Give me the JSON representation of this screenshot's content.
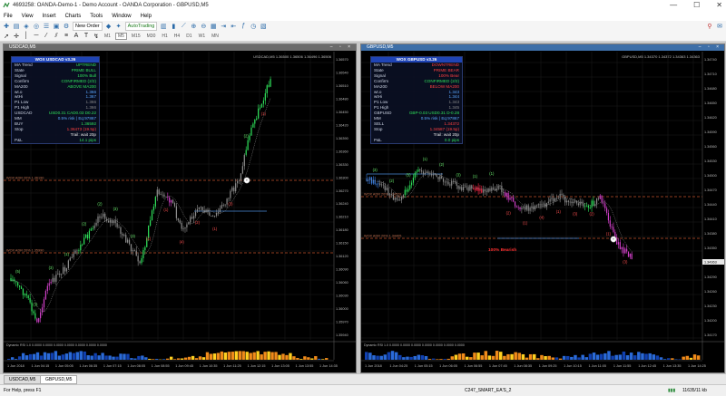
{
  "window": {
    "title": "4693258: OANDA-Demo-1 - Demo Account - OANDA Corporation - GBPUSD,M5",
    "controls": [
      "—",
      "☐",
      "✕"
    ]
  },
  "menu": [
    "File",
    "View",
    "Insert",
    "Charts",
    "Tools",
    "Window",
    "Help"
  ],
  "toolbar": {
    "new_order": "New Order",
    "autotrading": "AutoTrading",
    "timeframes": [
      "M1",
      "M5",
      "M15",
      "M30",
      "H1",
      "H4",
      "D1",
      "W1",
      "MN"
    ]
  },
  "left_chart": {
    "caption": "USDCAD,M5",
    "symbol_line": "USDCAD,M5 1.36500 1.36506 1.36496 1.36506",
    "indicator_caption": "Dynamic RSI 1.0 0.0000 0.0000 0.0000 0.0000 0.0000 0.0000 0.0000",
    "level_label_1": "WOX ADR 20% 1.36190",
    "level_label_2": "WOX ADR 20% 1.35990",
    "price_axis": [
      "1.36570",
      "1.36540",
      "1.36510",
      "1.36480",
      "1.36450",
      "1.36420",
      "1.36390",
      "1.36360",
      "1.36330",
      "1.36300",
      "1.36270",
      "1.36240",
      "1.36210",
      "1.36180",
      "1.36150",
      "1.36120",
      "1.36090",
      "1.36060",
      "1.36030",
      "1.36000",
      "1.35970",
      "1.35940"
    ],
    "time_axis": [
      "1 Jun 2018",
      "1 Jun 04:15",
      "1 Jun 05:05",
      "1 Jun 06:35",
      "1 Jun 07:15",
      "1 Jun 08:05",
      "1 Jun 08:55",
      "1 Jun 09:45",
      "1 Jun 10:35",
      "1 Jun 11:25",
      "1 Jun 12:15",
      "1 Jun 13:05",
      "1 Jun 13:55",
      "1 Jun 14:35"
    ],
    "panel": {
      "title": "WOX USDCAD v3.26",
      "rows": [
        {
          "k": "MA Trend",
          "v": "UPTREND",
          "c": "g"
        },
        {
          "k": "State",
          "v": "PRIME BULL",
          "c": "g"
        },
        {
          "k": "Signal",
          "v": "100% Bull",
          "c": "g"
        },
        {
          "k": "Confirm",
          "v": "CONFIRMED (2/2)",
          "c": "g"
        },
        {
          "k": "MA200",
          "v": "ABOVE MA200",
          "c": "g"
        },
        {
          "k": "wt.o",
          "v": "1.366",
          "c": "b"
        },
        {
          "k": "wtHi",
          "v": "1.367",
          "c": "b"
        },
        {
          "k": "P1 Low",
          "v": "1.366",
          "c": "gr"
        },
        {
          "k": "P1 High",
          "v": "1.366",
          "c": "gr"
        },
        {
          "k": "USDCAD",
          "v": "USD0.31 CAD0.03 D0.22",
          "c": "g"
        },
        {
          "k": "MM",
          "v": "0.5% risk | Eq:97867",
          "c": "b"
        },
        {
          "k": "BUY",
          "v": "1.36592",
          "c": "g"
        },
        {
          "k": "Stop",
          "v": "1.36473 (19.5p)",
          "c": "r"
        },
        {
          "k": "",
          "v": "Trail: wait 20p",
          "c": "w"
        },
        {
          "k": "P&L",
          "v": "14.1 pips",
          "c": "g"
        }
      ]
    },
    "swing_labels": [
      {
        "t": "(5)",
        "c": "g"
      },
      {
        "t": "(3)",
        "c": "g"
      },
      {
        "t": "(3)",
        "c": "g"
      },
      {
        "t": "(1)",
        "c": "g"
      },
      {
        "t": "(2)",
        "c": "g"
      },
      {
        "t": "(2)",
        "c": "g"
      },
      {
        "t": "(3)",
        "c": "g"
      },
      {
        "t": "(3)",
        "c": "g"
      },
      {
        "t": "(1)",
        "c": "r"
      },
      {
        "t": "(1)",
        "c": "r"
      },
      {
        "t": "(4)",
        "c": "r"
      },
      {
        "t": "(2)",
        "c": "r"
      },
      {
        "t": "(1)",
        "c": "r"
      },
      {
        "t": "(3)",
        "c": "r"
      },
      {
        "t": "(2)",
        "c": "g"
      },
      {
        "t": "(1)",
        "c": "r"
      }
    ]
  },
  "right_chart": {
    "caption": "GBPUSD,M5",
    "symbol_line": "GBPUSD,M5 1.34370 1.34372 1.34363 1.34363",
    "indicator_caption": "Dynamic RSI 1.0 0.0000 0.0000 0.0000 0.0000 0.0000 0.0000 0.0000",
    "level_label_1": "WOX ADR 20% 1.34528",
    "level_label_2": "WOX ADR 20% 1.34405",
    "signal_text": "100% Bearish",
    "current_price": "1.34363",
    "price_axis": [
      "1.34740",
      "1.34710",
      "1.34680",
      "1.34650",
      "1.34620",
      "1.34590",
      "1.34560",
      "1.34530",
      "1.34500",
      "1.34470",
      "1.34440",
      "1.34410",
      "1.34380",
      "1.34350",
      "1.34320",
      "1.34290",
      "1.34260",
      "1.34230",
      "1.34200",
      "1.34170"
    ],
    "time_axis": [
      "1 Jun 2018",
      "1 Jun 04:25",
      "1 Jun 05:15",
      "1 Jun 06:05",
      "1 Jun 06:55",
      "1 Jun 07:45",
      "1 Jun 08:35",
      "1 Jun 09:25",
      "1 Jun 10:15",
      "1 Jun 11:05",
      "1 Jun 11:55",
      "1 Jun 12:45",
      "1 Jun 13:35",
      "1 Jun 14:25"
    ],
    "panel": {
      "title": "WOX GBPUSD v3.26",
      "rows": [
        {
          "k": "MA Trend",
          "v": "DOWNTREND",
          "c": "r"
        },
        {
          "k": "State",
          "v": "PRIME BEAR",
          "c": "r"
        },
        {
          "k": "Signal",
          "v": "100% Bear",
          "c": "r"
        },
        {
          "k": "Confirm",
          "v": "CONFIRMED (2/2)",
          "c": "g"
        },
        {
          "k": "MA200",
          "v": "BELOW MA200",
          "c": "r"
        },
        {
          "k": "wt.o",
          "v": "1.343",
          "c": "b"
        },
        {
          "k": "wtHi",
          "v": "1.344",
          "c": "b"
        },
        {
          "k": "P1 Low",
          "v": "1.343",
          "c": "gr"
        },
        {
          "k": "P1 High",
          "v": "1.345",
          "c": "gr"
        },
        {
          "k": "GBPUSD",
          "v": "GBP-0.03 USD0.31 D-0.28",
          "c": "g"
        },
        {
          "k": "MM",
          "v": "0.5% risk | Eq:97867",
          "c": "b"
        },
        {
          "k": "SELL",
          "v": "1.34372",
          "c": "r"
        },
        {
          "k": "Stop",
          "v": "1.34587 (19.5p)",
          "c": "r"
        },
        {
          "k": "",
          "v": "Trail: wait 20p",
          "c": "w"
        },
        {
          "k": "P&L",
          "v": "0.0 pips",
          "c": "g"
        }
      ]
    },
    "swing_labels": [
      {
        "t": "(3)",
        "c": "g"
      },
      {
        "t": "(2)",
        "c": "g"
      },
      {
        "t": "(5)",
        "c": "g"
      },
      {
        "t": "(1)",
        "c": "g"
      },
      {
        "t": "(2)",
        "c": "g"
      },
      {
        "t": "(3)",
        "c": "g"
      },
      {
        "t": "(1)",
        "c": "g"
      },
      {
        "t": "(1)",
        "c": "g"
      },
      {
        "t": "(2)",
        "c": "r"
      },
      {
        "t": "(1)",
        "c": "r"
      },
      {
        "t": "(4)",
        "c": "r"
      },
      {
        "t": "(1)",
        "c": "r"
      },
      {
        "t": "(3)",
        "c": "r"
      },
      {
        "t": "(2)",
        "c": "r"
      },
      {
        "t": "(1)",
        "c": "r"
      },
      {
        "t": "(3)",
        "c": "r"
      }
    ]
  },
  "tabs": [
    "USDCAD,M5",
    "GBPUSD,M5"
  ],
  "status": {
    "help": "For Help, press F1",
    "profile": "C247_SMART_EA'S_2",
    "traffic": "11635/11 kb"
  },
  "colors": {
    "bull": "#2fe05a",
    "bear": "#ff2a4a",
    "neutral": "#8c8c8c",
    "accent_blue": "#1f44b5",
    "level": "#c0502a"
  }
}
